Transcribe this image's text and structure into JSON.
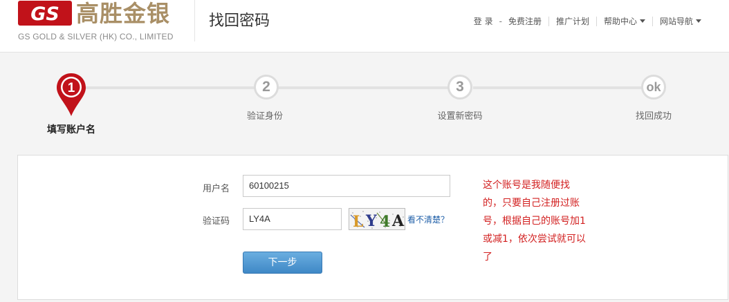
{
  "brand": {
    "logo_mark": "GS",
    "name_cn": "高胜金银",
    "name_en": "GS GOLD & SILVER (HK) CO., LIMITED"
  },
  "header": {
    "page_title": "找回密码",
    "nav": {
      "login": "登 录",
      "separator": "-",
      "register": "免费注册",
      "promotion": "推广计划",
      "help_center": "帮助中心",
      "site_nav": "网站导航"
    }
  },
  "steps": [
    {
      "number": "1",
      "label": "填写账户名",
      "active": true
    },
    {
      "number": "2",
      "label": "验证身份",
      "active": false
    },
    {
      "number": "3",
      "label": "设置新密码",
      "active": false
    },
    {
      "number": "ok",
      "label": "找回成功",
      "active": false
    }
  ],
  "form": {
    "username_label": "用户名",
    "username_value": "60100215",
    "captcha_label": "验证码",
    "captcha_value": "LY4A",
    "captcha_image_text": "LY4A",
    "captcha_refresh_link": "看不清楚？",
    "next_button": "下一步"
  },
  "annotation": {
    "text": "这个账号是我随便找的，只要自己注册过账号，根据自己的账号加1或减1，依次尝试就可以了"
  },
  "colors": {
    "brand_red": "#c1121a",
    "brand_gold": "#a98f66",
    "active_step": "#c1121a",
    "button_blue": "#3f88c6",
    "annotation_red": "#d21f1f",
    "link_blue": "#1f5fa8"
  }
}
